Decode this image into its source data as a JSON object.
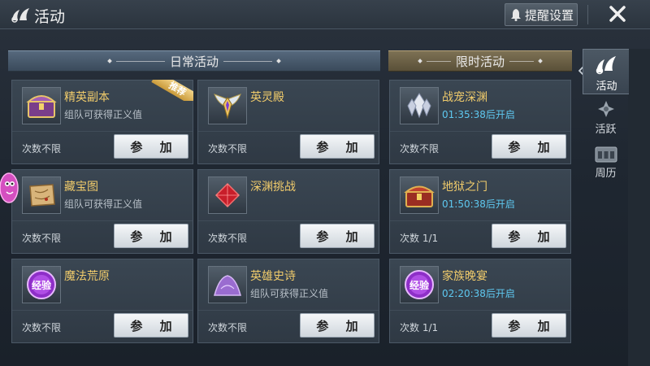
{
  "header": {
    "title": "活动",
    "remind_label": "提醒设置",
    "close_icon": "close-x"
  },
  "sections": {
    "daily": "日常活动",
    "limited": "限时活动"
  },
  "join_label": "参 加",
  "recommend_badge": "推荐",
  "cards": [
    {
      "name": "精英副本",
      "desc": "组队可获得正义值",
      "count": "次数不限",
      "icon": "treasure-chest"
    },
    {
      "name": "英灵殿",
      "desc": "",
      "count": "次数不限",
      "icon": "winged-emblem"
    },
    {
      "name": "战宠深渊",
      "desc": "01:35:38后开启",
      "count": "次数不限",
      "icon": "crystal"
    },
    {
      "name": "藏宝图",
      "desc": "组队可获得正义值",
      "count": "次数不限",
      "icon": "scroll-map"
    },
    {
      "name": "深渊挑战",
      "desc": "",
      "count": "次数不限",
      "icon": "red-gem"
    },
    {
      "name": "地狱之门",
      "desc": "01:50:38后开启",
      "count": "次数 1/1",
      "icon": "red-chest"
    },
    {
      "name": "魔法荒原",
      "desc": "",
      "count": "次数不限",
      "icon": "exp-orb",
      "orb_text": "经验"
    },
    {
      "name": "英雄史诗",
      "desc": "组队可获得正义值",
      "count": "次数不限",
      "icon": "purple-mound"
    },
    {
      "name": "家族晚宴",
      "desc": "02:20:38后开启",
      "count": "次数 1/1",
      "icon": "exp-orb",
      "orb_text": "经验"
    }
  ],
  "side_tabs": [
    {
      "label": "活动",
      "active": true
    },
    {
      "label": "活跃",
      "active": false
    },
    {
      "label": "周历",
      "active": false
    }
  ],
  "colors": {
    "card_name": "#f0cb6b",
    "timer": "#5ec8f0",
    "button_bg": "#e6eaee"
  }
}
